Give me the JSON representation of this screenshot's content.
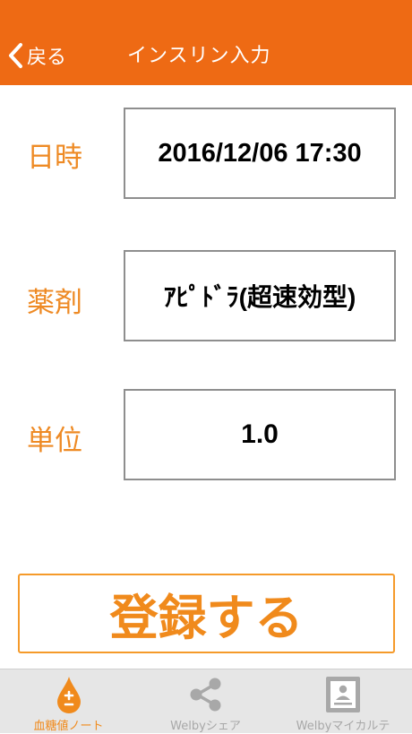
{
  "header": {
    "back_label": "戻る",
    "title": "インスリン入力"
  },
  "form": {
    "datetime_label": "日時",
    "datetime_value": "2016/12/06 17:30",
    "drug_label": "薬剤",
    "drug_value": "ｱﾋﾟﾄﾞﾗ(超速効型)",
    "unit_label": "単位",
    "unit_value": "1.0"
  },
  "register_label": "登録する",
  "tabbar": {
    "tabs": [
      {
        "label": "血糖値ノート",
        "icon": "blood-drop-icon",
        "active": true
      },
      {
        "label": "Welbyシェア",
        "icon": "share-icon",
        "active": false
      },
      {
        "label": "Welbyマイカルテ",
        "icon": "medical-record-icon",
        "active": false
      }
    ]
  },
  "colors": {
    "primary": "#EE6A14",
    "label_orange": "#EE8A24",
    "tab_active": "#F08A1C",
    "tab_inactive": "#A8A8A8",
    "tabbar_bg": "#E6E6E6"
  }
}
